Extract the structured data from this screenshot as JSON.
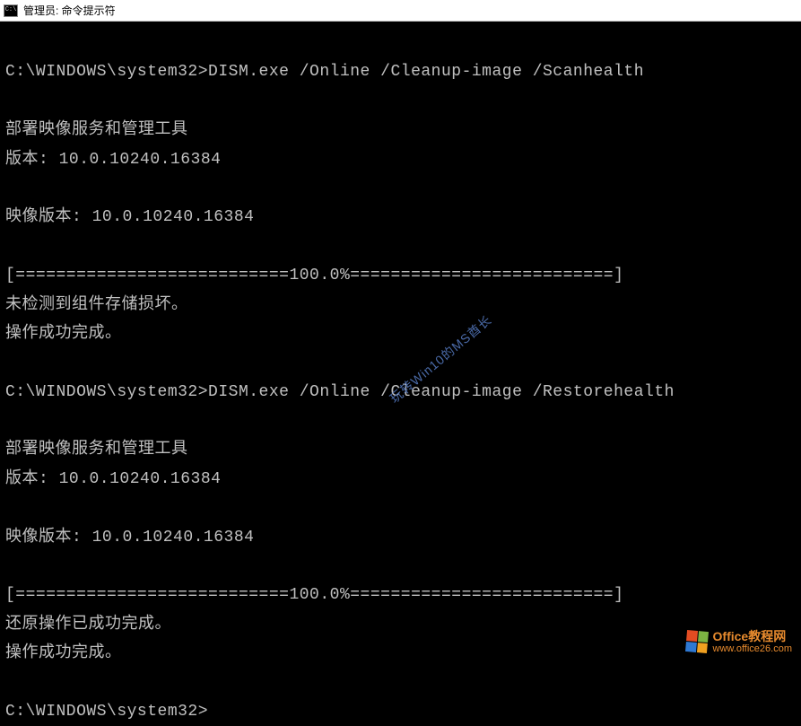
{
  "window": {
    "icon_label": "C:\\",
    "title": "管理员: 命令提示符"
  },
  "terminal": {
    "lines": [
      "",
      "C:\\WINDOWS\\system32>DISM.exe /Online /Cleanup-image /Scanhealth",
      "",
      "部署映像服务和管理工具",
      "版本: 10.0.10240.16384",
      "",
      "映像版本: 10.0.10240.16384",
      "",
      "[===========================100.0%==========================]",
      "未检测到组件存储损坏。",
      "操作成功完成。",
      "",
      "C:\\WINDOWS\\system32>DISM.exe /Online /Cleanup-image /Restorehealth",
      "",
      "部署映像服务和管理工具",
      "版本: 10.0.10240.16384",
      "",
      "映像版本: 10.0.10240.16384",
      "",
      "[===========================100.0%==========================]",
      "还原操作已成功完成。",
      "操作成功完成。",
      "",
      "C:\\WINDOWS\\system32>"
    ]
  },
  "watermark": {
    "text": "玩转Win10的MS酋长"
  },
  "brand": {
    "title": "Office教程网",
    "url": "www.office26.com"
  }
}
